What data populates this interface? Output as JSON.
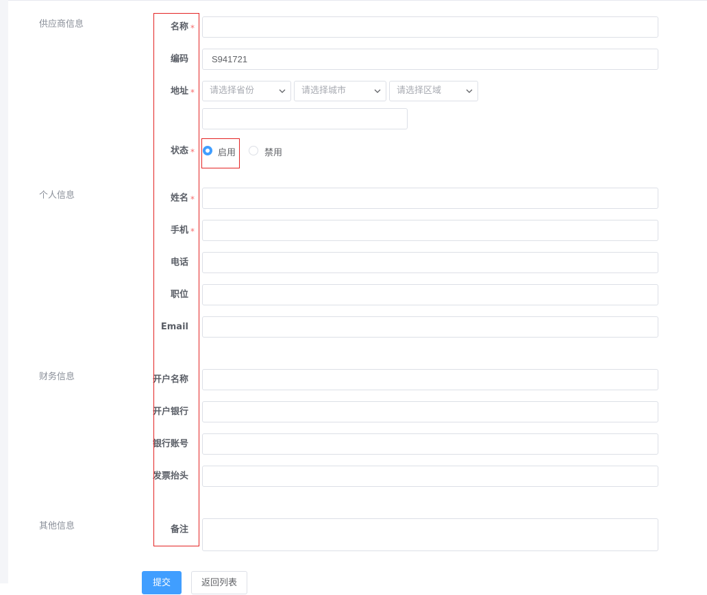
{
  "sections": {
    "supplier": "供应商信息",
    "personal": "个人信息",
    "finance": "财务信息",
    "other": "其他信息"
  },
  "fields": {
    "name": {
      "label": "名称",
      "value": ""
    },
    "code": {
      "label": "编码",
      "value": "S941721"
    },
    "address": {
      "label": "地址",
      "province_placeholder": "请选择省份",
      "city_placeholder": "请选择城市",
      "district_placeholder": "请选择区域",
      "detail_value": ""
    },
    "status": {
      "label": "状态",
      "option_enabled": "启用",
      "option_disabled": "禁用",
      "selected": "启用"
    },
    "contact_name": {
      "label": "姓名",
      "value": ""
    },
    "mobile": {
      "label": "手机",
      "value": ""
    },
    "phone": {
      "label": "电话",
      "value": ""
    },
    "position": {
      "label": "职位",
      "value": ""
    },
    "email": {
      "label": "Email",
      "value": ""
    },
    "account_name": {
      "label": "开户名称",
      "value": ""
    },
    "bank": {
      "label": "开户银行",
      "value": ""
    },
    "account_no": {
      "label": "银行账号",
      "value": ""
    },
    "invoice_title": {
      "label": "发票抬头",
      "value": ""
    },
    "remark": {
      "label": "备注",
      "value": ""
    }
  },
  "required_mark": "*",
  "buttons": {
    "submit": "提交",
    "back": "返回列表"
  },
  "colors": {
    "primary": "#409eff",
    "required": "#f56c6c",
    "annotation": "#e32020"
  }
}
